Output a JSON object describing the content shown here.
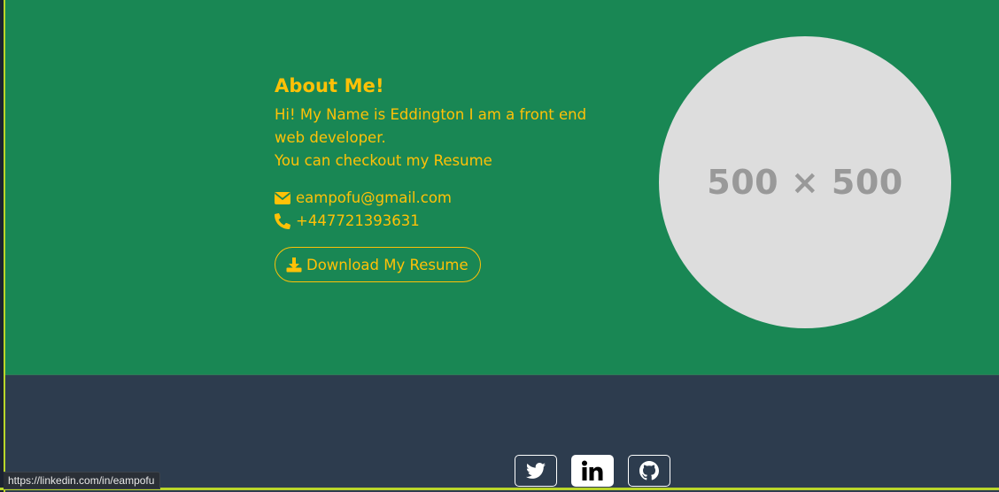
{
  "about": {
    "title": "About Me!",
    "intro": "Hi! My Name is Eddington I am a front end web developer.",
    "resume_line": "You can checkout my Resume",
    "email": "eampofu@gmail.com",
    "phone": "+447721393631",
    "email_icon": "envelope-icon",
    "phone_icon": "phone-icon",
    "download_label": "Download My Resume",
    "download_icon": "download-icon"
  },
  "profile_image": {
    "placeholder": "500 × 500"
  },
  "footer": {
    "social": [
      {
        "name": "twitter",
        "icon": "twitter-icon"
      },
      {
        "name": "linkedin",
        "icon": "linkedin-icon",
        "active": true
      },
      {
        "name": "github",
        "icon": "github-icon"
      }
    ]
  },
  "status_bar": {
    "hover_url": "https://linkedin.com/in/eampofu"
  },
  "colors": {
    "about_bg": "#198754",
    "accent": "#ffc107",
    "footer_bg": "#2d3c4e",
    "placeholder_bg": "#dddddd"
  }
}
